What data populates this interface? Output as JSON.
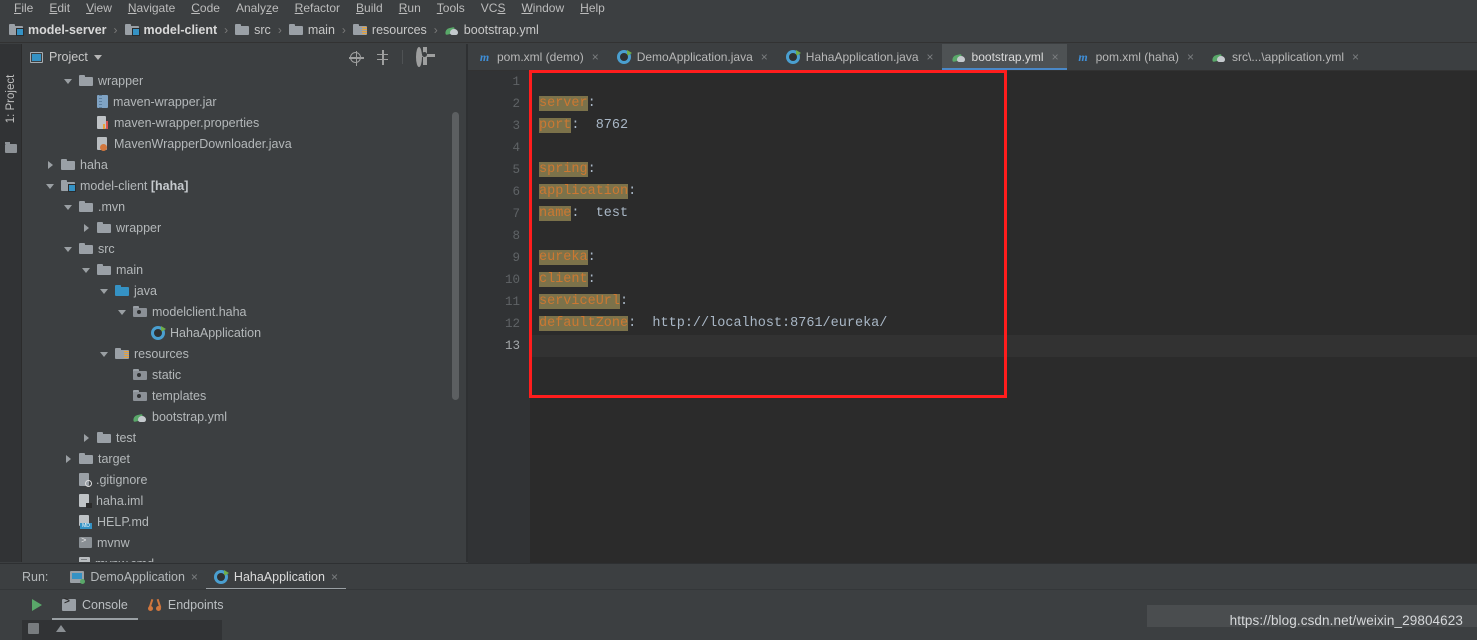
{
  "menubar": {
    "items": [
      {
        "label": "File",
        "mnemonic": "F"
      },
      {
        "label": "Edit",
        "mnemonic": "E"
      },
      {
        "label": "View",
        "mnemonic": "V"
      },
      {
        "label": "Navigate",
        "mnemonic": "N"
      },
      {
        "label": "Code",
        "mnemonic": "C"
      },
      {
        "label": "Analyze",
        "mnemonic": "z"
      },
      {
        "label": "Refactor",
        "mnemonic": "R"
      },
      {
        "label": "Build",
        "mnemonic": "B"
      },
      {
        "label": "Run",
        "mnemonic": "R"
      },
      {
        "label": "Tools",
        "mnemonic": "T"
      },
      {
        "label": "VCS",
        "mnemonic": "S"
      },
      {
        "label": "Window",
        "mnemonic": "W"
      },
      {
        "label": "Help",
        "mnemonic": "H"
      }
    ]
  },
  "breadcrumb": {
    "separator": "›",
    "items": [
      {
        "label": "model-server",
        "icon": "module-folder-icon",
        "bold": true
      },
      {
        "label": "model-client",
        "icon": "module-folder-icon",
        "bold": true
      },
      {
        "label": "src",
        "icon": "folder-icon",
        "bold": false
      },
      {
        "label": "main",
        "icon": "folder-icon",
        "bold": false
      },
      {
        "label": "resources",
        "icon": "resources-folder-icon",
        "bold": false
      },
      {
        "label": "bootstrap.yml",
        "icon": "yaml-file-icon",
        "bold": false
      }
    ]
  },
  "toolstrip": {
    "project_tab": "1: Project",
    "project_tab_mnemonic": "1"
  },
  "project_panel": {
    "title": "Project",
    "tools": [
      {
        "name": "locate-icon",
        "label": "Select Opened File"
      },
      {
        "name": "collapse-all-icon",
        "label": "Collapse All"
      },
      {
        "name": "gear-icon",
        "label": "Settings"
      },
      {
        "name": "minimize-icon",
        "label": "Hide"
      }
    ],
    "tree": [
      {
        "label": "wrapper",
        "indent": 2,
        "arrow": "down",
        "icon": "folder-icon"
      },
      {
        "label": "maven-wrapper.jar",
        "indent": 3,
        "arrow": "none",
        "icon": "jar-file-icon"
      },
      {
        "label": "maven-wrapper.properties",
        "indent": 3,
        "arrow": "none",
        "icon": "properties-file-icon"
      },
      {
        "label": "MavenWrapperDownloader.java",
        "indent": 3,
        "arrow": "none",
        "icon": "java-file-icon"
      },
      {
        "label": "haha",
        "indent": 1,
        "arrow": "right",
        "icon": "folder-icon"
      },
      {
        "label": "model-client ",
        "indent": 1,
        "arrow": "down",
        "icon": "module-folder-icon",
        "suffix": "[haha]"
      },
      {
        "label": ".mvn",
        "indent": 2,
        "arrow": "down",
        "icon": "folder-icon"
      },
      {
        "label": "wrapper",
        "indent": 3,
        "arrow": "right",
        "icon": "folder-icon"
      },
      {
        "label": "src",
        "indent": 2,
        "arrow": "down",
        "icon": "folder-icon"
      },
      {
        "label": "main",
        "indent": 3,
        "arrow": "down",
        "icon": "folder-icon"
      },
      {
        "label": "java",
        "indent": 4,
        "arrow": "down",
        "icon": "source-folder-icon"
      },
      {
        "label": "modelclient.haha",
        "indent": 5,
        "arrow": "down",
        "icon": "package-icon"
      },
      {
        "label": "HahaApplication",
        "indent": 6,
        "arrow": "none",
        "icon": "spring-boot-class-icon"
      },
      {
        "label": "resources",
        "indent": 4,
        "arrow": "down",
        "icon": "resources-folder-icon"
      },
      {
        "label": "static",
        "indent": 5,
        "arrow": "none",
        "icon": "package-icon"
      },
      {
        "label": "templates",
        "indent": 5,
        "arrow": "none",
        "icon": "package-icon"
      },
      {
        "label": "bootstrap.yml",
        "indent": 5,
        "arrow": "none",
        "icon": "yaml-file-icon"
      },
      {
        "label": "test",
        "indent": 3,
        "arrow": "right",
        "icon": "folder-icon"
      },
      {
        "label": "target",
        "indent": 2,
        "arrow": "right",
        "icon": "folder-icon"
      },
      {
        "label": ".gitignore",
        "indent": 2,
        "arrow": "none",
        "icon": "gitignore-file-icon"
      },
      {
        "label": "haha.iml",
        "indent": 2,
        "arrow": "none",
        "icon": "iml-file-icon"
      },
      {
        "label": "HELP.md",
        "indent": 2,
        "arrow": "none",
        "icon": "markdown-file-icon"
      },
      {
        "label": "mvnw",
        "indent": 2,
        "arrow": "none",
        "icon": "shell-script-icon"
      },
      {
        "label": "mvnw.cmd",
        "indent": 2,
        "arrow": "none",
        "icon": "cmd-script-icon"
      }
    ]
  },
  "editor": {
    "tabs": [
      {
        "label": "pom.xml (demo)",
        "icon": "maven-icon",
        "active": false,
        "close": "×"
      },
      {
        "label": "DemoApplication.java",
        "icon": "spring-boot-icon",
        "active": false,
        "close": "×"
      },
      {
        "label": "HahaApplication.java",
        "icon": "spring-boot-icon",
        "active": false,
        "close": "×"
      },
      {
        "label": "bootstrap.yml",
        "icon": "yaml-file-icon",
        "active": true,
        "close": "×"
      },
      {
        "label": "pom.xml (haha)",
        "icon": "maven-icon",
        "active": false,
        "close": "×"
      },
      {
        "label": "src\\...\\application.yml",
        "icon": "yaml-file-icon",
        "active": false,
        "close": "×"
      }
    ],
    "line_numbers": [
      "1",
      "2",
      "3",
      "4",
      "5",
      "6",
      "7",
      "8",
      "9",
      "10",
      "11",
      "12",
      "13"
    ],
    "current_line": 13,
    "lines": [
      {
        "n": 1,
        "key": "",
        "rest": ""
      },
      {
        "n": 2,
        "key": "server",
        "rest": ":"
      },
      {
        "n": 3,
        "key": "port",
        "rest": ":  8762"
      },
      {
        "n": 4,
        "key": "",
        "rest": ""
      },
      {
        "n": 5,
        "key": "spring",
        "rest": ":"
      },
      {
        "n": 6,
        "key": "application",
        "rest": ":"
      },
      {
        "n": 7,
        "key": "name",
        "rest": ":  test"
      },
      {
        "n": 8,
        "key": "",
        "rest": ""
      },
      {
        "n": 9,
        "key": "eureka",
        "rest": ":"
      },
      {
        "n": 10,
        "key": "client",
        "rest": ":"
      },
      {
        "n": 11,
        "key": "serviceUrl",
        "rest": ":"
      },
      {
        "n": 12,
        "key": "defaultZone",
        "rest": ":  http://localhost:8761/eureka/"
      },
      {
        "n": 13,
        "key": "",
        "rest": ""
      }
    ]
  },
  "annotation": {
    "color": "#ff1d1d",
    "shape": "rectangle"
  },
  "run_panel": {
    "label": "Run:",
    "tabs": [
      {
        "label": "DemoApplication",
        "icon": "application-icon",
        "active": false,
        "close": "×"
      },
      {
        "label": "HahaApplication",
        "icon": "spring-boot-icon",
        "active": true,
        "close": "×"
      }
    ],
    "run_button": "run-icon",
    "view_tabs": [
      {
        "label": "Console",
        "icon": "console-icon",
        "active": true
      },
      {
        "label": "Endpoints",
        "icon": "endpoints-icon",
        "active": false
      }
    ]
  },
  "watermark": {
    "text": "https://blog.csdn.net/weixin_29804623"
  },
  "colors": {
    "background": "#3c3f41",
    "editor_background": "#2b2b2b",
    "accent_blue": "#4a88c7",
    "yaml_key": "#cc7832",
    "yaml_key_highlight": "#7c724a",
    "annotation_red": "#ff1d1d",
    "run_green": "#59a869"
  }
}
